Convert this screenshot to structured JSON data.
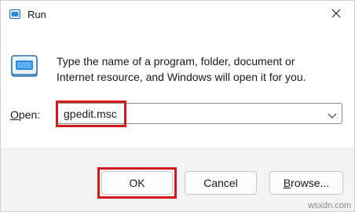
{
  "window": {
    "title": "Run",
    "app_icon": "run-icon",
    "close_icon": "close-icon"
  },
  "description": {
    "line1": "Type the name of a program, folder, document or",
    "line2": "Internet resource, and Windows will open it for you."
  },
  "open_field": {
    "label_underlined": "O",
    "label_rest": "pen:",
    "value": "gpedit.msc",
    "dropdown_icon": "chevron-down-icon"
  },
  "buttons": {
    "ok": "OK",
    "cancel": "Cancel",
    "browse_underlined": "B",
    "browse_rest": "rowse..."
  },
  "annotations": {
    "highlight_color": "#d31a1a"
  },
  "watermark": "wsxdn.com"
}
